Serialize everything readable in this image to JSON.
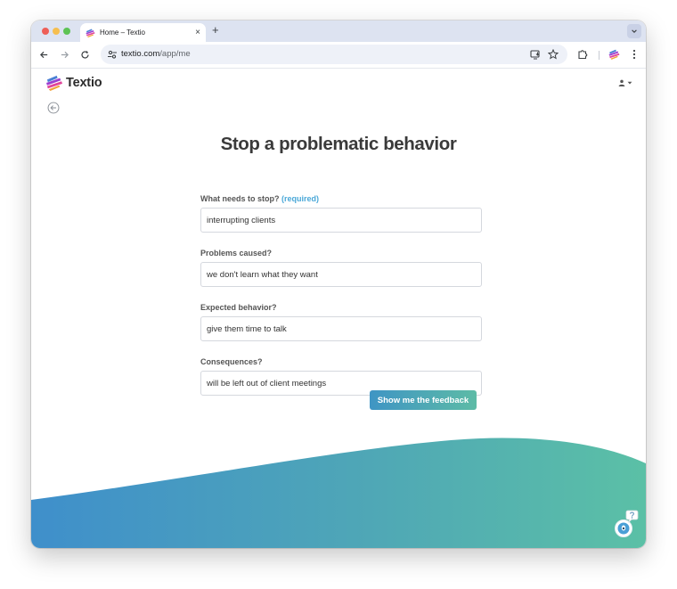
{
  "browser": {
    "tab_title": "Home – Textio",
    "tab_close": "×",
    "new_tab": "+",
    "url_host": "textio.com",
    "url_path": "/app/me"
  },
  "app": {
    "logo_text": "Textio"
  },
  "page": {
    "heading": "Stop a problematic behavior",
    "fields": [
      {
        "label": "What needs to stop?",
        "required": "(required)",
        "value": "interrupting clients"
      },
      {
        "label": "Problems caused?",
        "value": "we don't learn what they want"
      },
      {
        "label": "Expected behavior?",
        "value": "give them time to talk"
      },
      {
        "label": "Consequences?",
        "value": "will be left out of client meetings"
      }
    ],
    "submit_label": "Show me the feedback"
  },
  "icons": {
    "back": "back-arrow-circle-icon",
    "user": "user-icon",
    "help": "help-chat-icon"
  },
  "colors": {
    "accent_blue": "#4aa8d8",
    "gradient_start": "#3f95c4",
    "gradient_end": "#5dbba6"
  }
}
